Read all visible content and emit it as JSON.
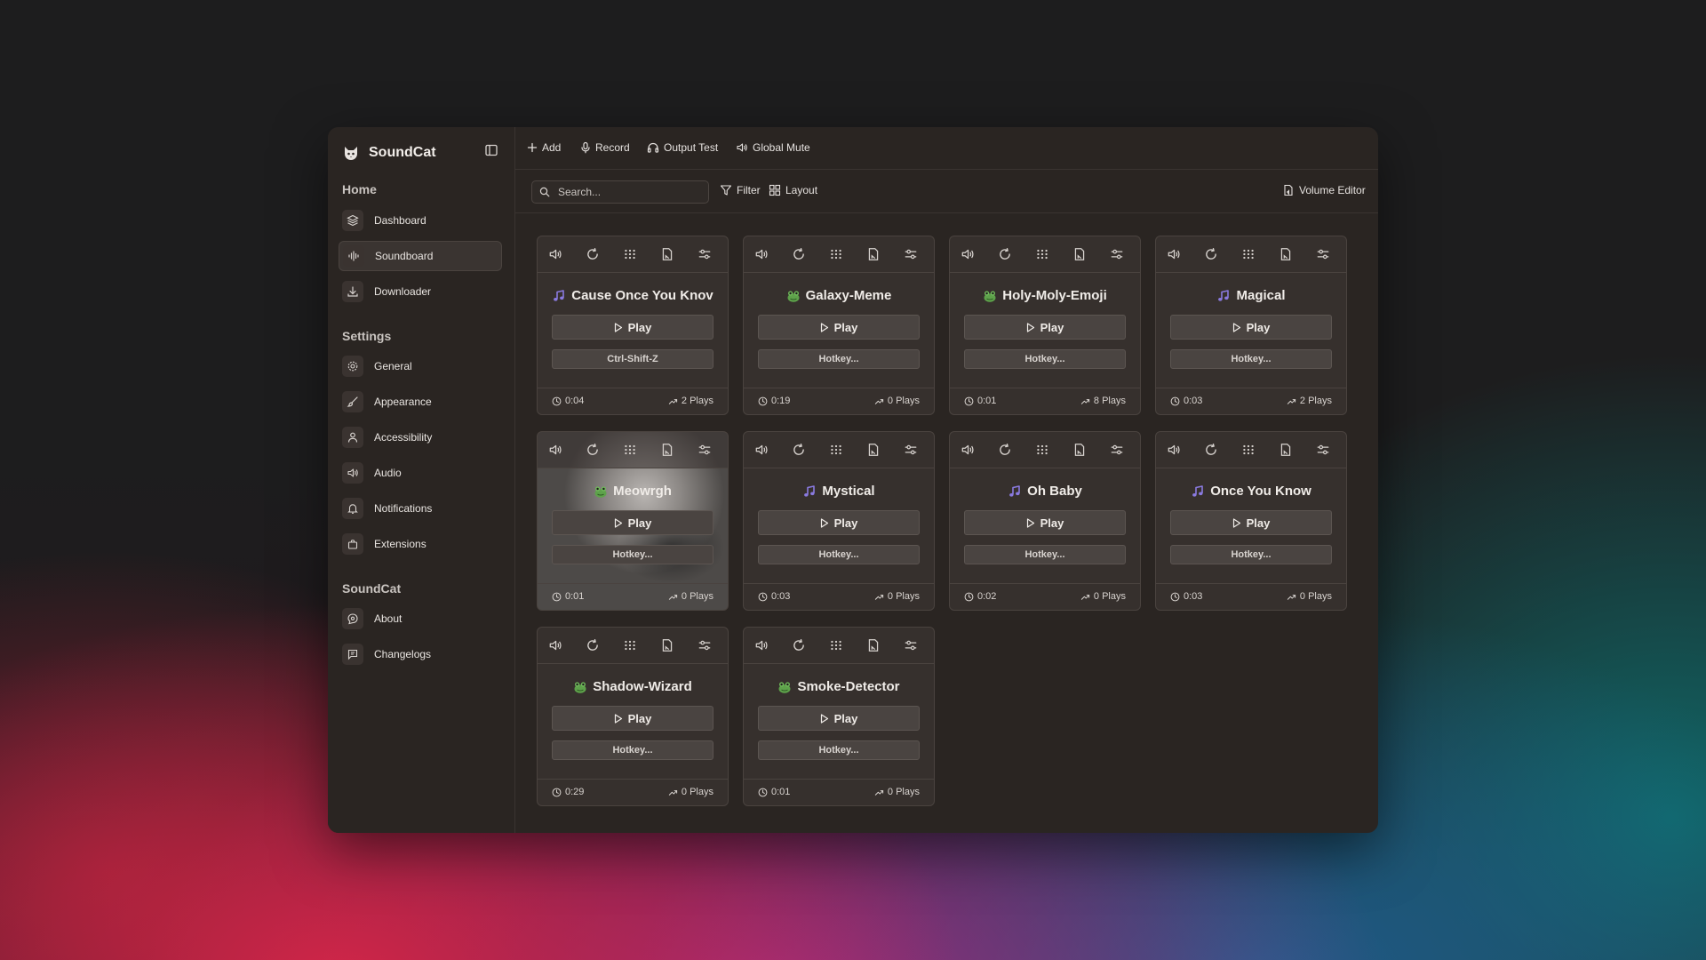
{
  "app": {
    "name": "SoundCat"
  },
  "sidebar": {
    "sections": [
      {
        "title": "Home",
        "items": [
          {
            "label": "Dashboard",
            "icon": "layers-icon"
          },
          {
            "label": "Soundboard",
            "icon": "audio-waveform-icon",
            "active": true
          },
          {
            "label": "Downloader",
            "icon": "download-icon"
          }
        ]
      },
      {
        "title": "Settings",
        "items": [
          {
            "label": "General",
            "icon": "gear-icon"
          },
          {
            "label": "Appearance",
            "icon": "brush-icon"
          },
          {
            "label": "Accessibility",
            "icon": "person-icon"
          },
          {
            "label": "Audio",
            "icon": "speaker-icon"
          },
          {
            "label": "Notifications",
            "icon": "bell-icon"
          },
          {
            "label": "Extensions",
            "icon": "puzzle-icon"
          }
        ]
      },
      {
        "title": "SoundCat",
        "items": [
          {
            "label": "About",
            "icon": "info-chat-icon"
          },
          {
            "label": "Changelogs",
            "icon": "flag-chat-icon"
          }
        ]
      }
    ]
  },
  "topbar": {
    "add": "Add",
    "record": "Record",
    "output_test": "Output Test",
    "global_mute": "Global Mute"
  },
  "toolbar": {
    "search_placeholder": "Search...",
    "filter": "Filter",
    "layout": "Layout",
    "volume_editor": "Volume Editor"
  },
  "play_label": "Play",
  "colors": {
    "accent_music": "#8a7ae0",
    "frog": "#5ea24b",
    "window_bg": "#2a2522",
    "card_bg": "#36302d"
  },
  "sounds": [
    {
      "title": "Cause Once You Knov",
      "icon": "music-note-icon",
      "hotkey": "Ctrl-Shift-Z",
      "duration": "0:04",
      "plays": "2 Plays"
    },
    {
      "title": "Galaxy-Meme",
      "icon": "frog-emoji-icon",
      "hotkey": "Hotkey...",
      "duration": "0:19",
      "plays": "0 Plays"
    },
    {
      "title": "Holy-Moly-Emoji",
      "icon": "frog-emoji-icon",
      "hotkey": "Hotkey...",
      "duration": "0:01",
      "plays": "8 Plays"
    },
    {
      "title": "Magical",
      "icon": "music-note-icon",
      "hotkey": "Hotkey...",
      "duration": "0:03",
      "plays": "2 Plays"
    },
    {
      "title": "Meowrgh",
      "icon": "frog-emoji-icon",
      "hotkey": "Hotkey...",
      "duration": "0:01",
      "plays": "0 Plays",
      "background_image": true
    },
    {
      "title": "Mystical",
      "icon": "music-note-icon",
      "hotkey": "Hotkey...",
      "duration": "0:03",
      "plays": "0 Plays"
    },
    {
      "title": "Oh Baby",
      "icon": "music-note-icon",
      "hotkey": "Hotkey...",
      "duration": "0:02",
      "plays": "0 Plays"
    },
    {
      "title": "Once You Know",
      "icon": "music-note-icon",
      "hotkey": "Hotkey...",
      "duration": "0:03",
      "plays": "0 Plays"
    },
    {
      "title": "Shadow-Wizard",
      "icon": "frog-emoji-icon",
      "hotkey": "Hotkey...",
      "duration": "0:29",
      "plays": "0 Plays"
    },
    {
      "title": "Smoke-Detector",
      "icon": "frog-emoji-icon",
      "hotkey": "Hotkey...",
      "duration": "0:01",
      "plays": "0 Plays"
    }
  ],
  "card_action_icons": [
    "volume-icon",
    "loop-icon",
    "grip-icon",
    "file-chart-icon",
    "settings-sliders-icon"
  ]
}
